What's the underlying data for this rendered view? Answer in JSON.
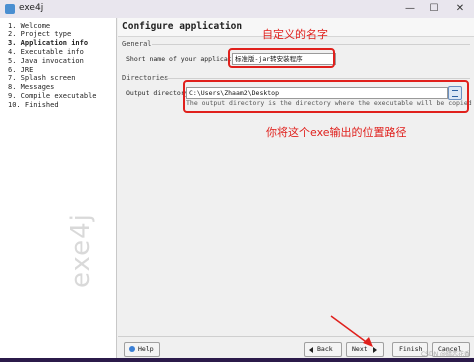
{
  "window": {
    "title": "exe4j",
    "minimize": "—",
    "maximize": "☐",
    "close": "✕"
  },
  "sidebar": {
    "steps": [
      {
        "label": "1. Welcome",
        "active": false
      },
      {
        "label": "2. Project type",
        "active": false
      },
      {
        "label": "3. Application info",
        "active": true
      },
      {
        "label": "4. Executable info",
        "active": false
      },
      {
        "label": "5. Java invocation",
        "active": false
      },
      {
        "label": "6. JRE",
        "active": false
      },
      {
        "label": "7. Splash screen",
        "active": false
      },
      {
        "label": "8. Messages",
        "active": false
      },
      {
        "label": "9. Compile executable",
        "active": false
      },
      {
        "label": "10. Finished",
        "active": false
      }
    ],
    "watermark": "exe4j"
  },
  "main": {
    "title": "Configure application",
    "general": {
      "section": "General",
      "short_name_label": "Short name of your application:",
      "short_name_value": "标准版-jar转安装程序"
    },
    "directories": {
      "section": "Directories",
      "output_label": "Output directory:",
      "output_value": "C:\\Users\\Zhaam2\\Desktop",
      "hint": "The output directory is the directory where the executable will be copied"
    }
  },
  "annotations": {
    "name_note": "自定义的名字",
    "path_note": "你将这个exe输出的位置路径"
  },
  "buttons": {
    "help": "Help",
    "back": "Back",
    "next": "Next",
    "finish": "Finish",
    "cancel": "Cancel"
  },
  "credit": "CSDN @暗恋花香"
}
